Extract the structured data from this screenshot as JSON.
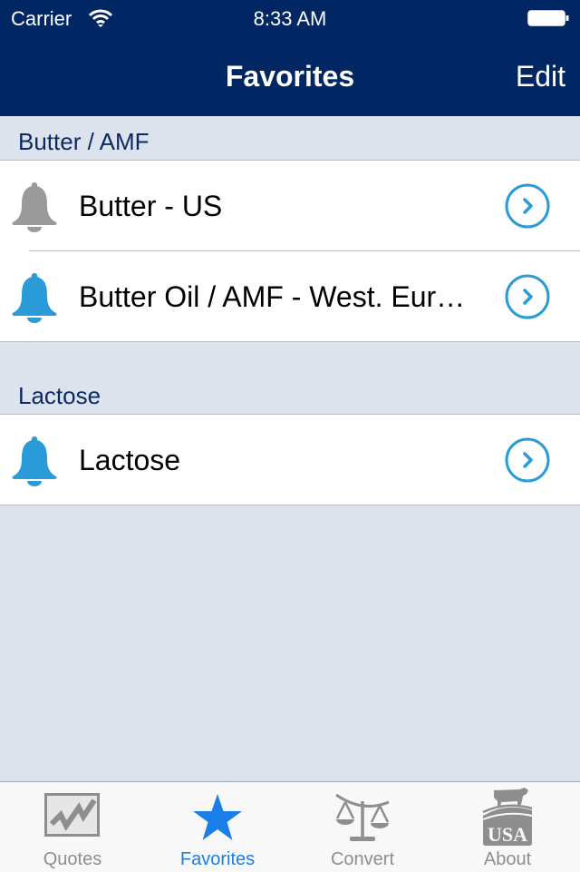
{
  "status_bar": {
    "carrier": "Carrier",
    "time": "8:33 AM"
  },
  "nav": {
    "title": "Favorites",
    "edit_label": "Edit"
  },
  "sections": [
    {
      "header": "Butter / AMF",
      "items": [
        {
          "label": "Butter - US",
          "alert_enabled": false
        },
        {
          "label": "Butter Oil / AMF - West. Europe",
          "alert_enabled": true
        }
      ]
    },
    {
      "header": "Lactose",
      "items": [
        {
          "label": "Lactose",
          "alert_enabled": true
        }
      ]
    }
  ],
  "tabbar": {
    "tabs": [
      {
        "label": "Quotes",
        "icon": "chart-icon",
        "active": false
      },
      {
        "label": "Favorites",
        "icon": "star-icon",
        "active": true
      },
      {
        "label": "Convert",
        "icon": "scale-icon",
        "active": false
      },
      {
        "label": "About",
        "icon": "usa-cow-icon",
        "active": false
      }
    ]
  },
  "colors": {
    "nav_bg": "#002663",
    "accent": "#1a7fe8",
    "bell_active": "#2a9ad8",
    "bell_inactive": "#9a9a9a",
    "list_bg": "#dde3ed"
  }
}
